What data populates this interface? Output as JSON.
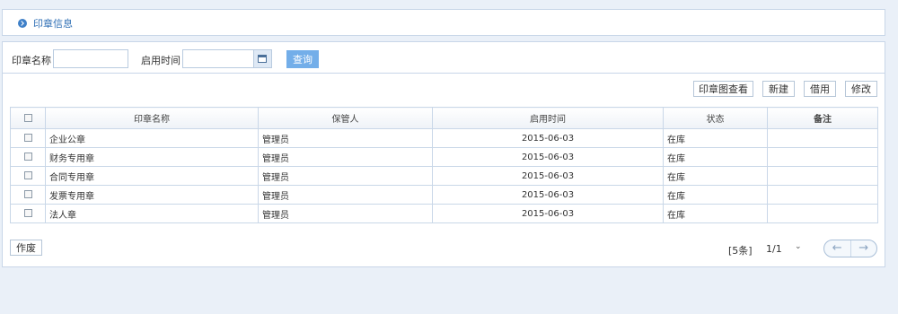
{
  "header": {
    "title": "印章信息"
  },
  "search": {
    "name_label": "印章名称",
    "name_value": "",
    "date_label": "启用时间",
    "date_value": "",
    "query_label": "查询"
  },
  "toolbar": {
    "view_label": "印章图查看",
    "new_label": "新建",
    "borrow_label": "借用",
    "edit_label": "修改"
  },
  "table": {
    "columns": [
      "印章名称",
      "保管人",
      "启用时间",
      "状态",
      "备注"
    ],
    "rows": [
      {
        "name": "企业公章",
        "keeper": "管理员",
        "date": "2015-06-03",
        "status": "在库",
        "note": ""
      },
      {
        "name": "财务专用章",
        "keeper": "管理员",
        "date": "2015-06-03",
        "status": "在库",
        "note": ""
      },
      {
        "name": "合同专用章",
        "keeper": "管理员",
        "date": "2015-06-03",
        "status": "在库",
        "note": ""
      },
      {
        "name": "发票专用章",
        "keeper": "管理员",
        "date": "2015-06-03",
        "status": "在库",
        "note": ""
      },
      {
        "name": "法人章",
        "keeper": "管理员",
        "date": "2015-06-03",
        "status": "在库",
        "note": ""
      }
    ]
  },
  "footer": {
    "void_label": "作废",
    "count_text": "[5条]",
    "page_text": "1/1",
    "caret_icon": "chevron-down-icon",
    "prev_icon": "arrow-left-icon",
    "next_icon": "arrow-right-icon"
  },
  "colors": {
    "accent": "#3f80c8",
    "button": "#73aee9",
    "border": "#c8d6e8",
    "background": "#eaf0f8"
  }
}
